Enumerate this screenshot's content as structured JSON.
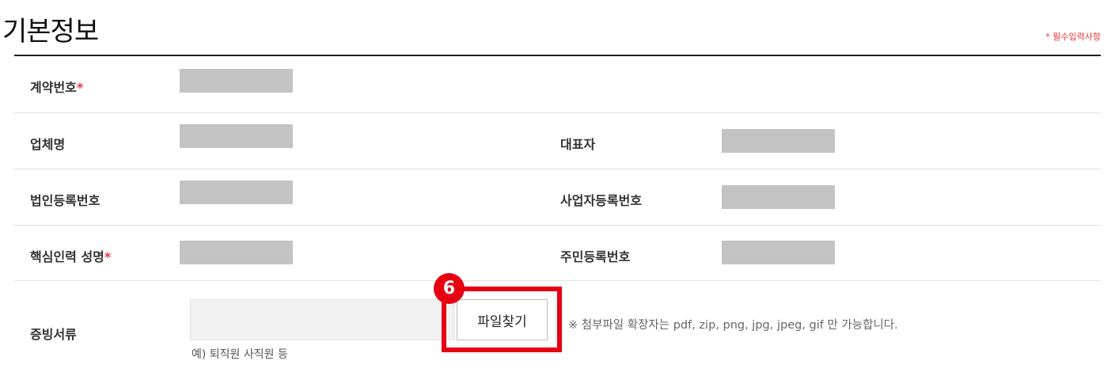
{
  "title": "기본정보",
  "required_note": "* 필수입력사항",
  "form": {
    "contract_no_label": "계약번호",
    "company_label": "업체명",
    "ceo_label": "대표자",
    "corp_reg_label": "법인등록번호",
    "biz_reg_label": "사업자등록번호",
    "key_person_label": "핵심인력 성명",
    "resident_reg_label": "주민등록번호",
    "evidence_label": "증빙서류",
    "required_mark": "*",
    "file_button": "파일찾기",
    "file_example": "예) 퇴직원 사직원 등",
    "file_notice": "※ 첨부파일 확장자는 pdf, zip, png, jpg, jpeg, gif 만 가능합니다."
  },
  "annotation": {
    "step_number": "6",
    "highlight_color": "#e60012"
  }
}
